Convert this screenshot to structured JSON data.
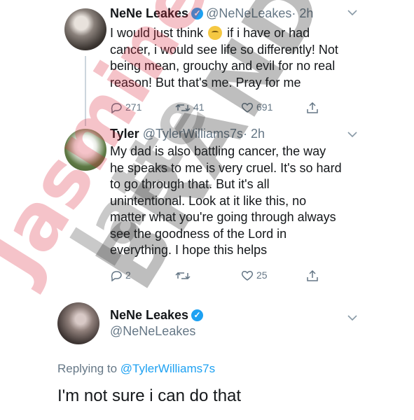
{
  "tweets": [
    {
      "name": "NeNe Leakes",
      "handle": "@NeNeLeakes",
      "time": "· 2h",
      "lines": [
        "I would just think",
        "if i have or had",
        "cancer, i would see life so differently! Not",
        "being mean, grouchy and evil for no real",
        "reason! But that's me. Pray for me"
      ],
      "replies": "271",
      "retweets": "41",
      "likes": "691"
    },
    {
      "name": "Tyler",
      "handle": "@TylerWilliams7s",
      "time": "· 2h",
      "lines": [
        "My dad is also battling cancer, the way",
        "he speaks to me is very cruel. It's so hard",
        "to go through that. But it's all",
        "unintentional. Look at it like this, no",
        "matter what you're going through always",
        "see the goodness of the Lord in",
        "everything. I hope this helps"
      ],
      "replies": "2",
      "retweets": "",
      "likes": "25"
    }
  ],
  "reply": {
    "name": "NeNe Leakes",
    "handle": "@NeNeLeakes",
    "replying_prefix": "Replying to",
    "replying_to": "@TylerWilliams7s",
    "text": "I'm not sure i can do that"
  },
  "watermark": {
    "line1": "latte",
    "line2": "BRAND",
    "line3": "Jasmine"
  },
  "colors": {
    "verified": "#1da1f2",
    "link": "#1da1f2",
    "muted": "#657786"
  },
  "icons": [
    "verified-badge-icon",
    "chevron-down-icon",
    "reply-icon",
    "retweet-icon",
    "like-icon",
    "share-icon",
    "thinking-face-emoji"
  ]
}
